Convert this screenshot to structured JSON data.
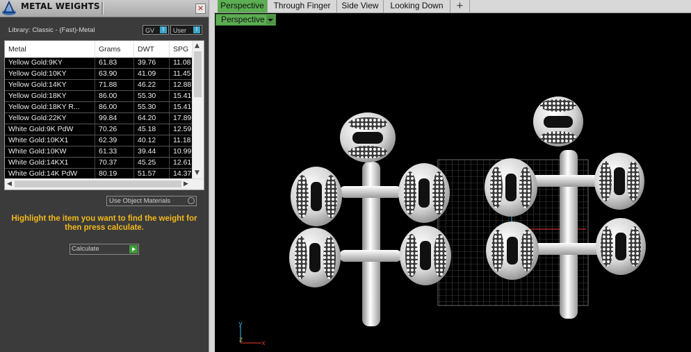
{
  "panel": {
    "title": "METAL WEIGHTS",
    "close_label": "×",
    "library_label": "Library: Classic - (Fast)-Metal",
    "gv_label": "GV",
    "gv_indicator": "I",
    "user_label": "User",
    "user_indicator": "I",
    "table": {
      "columns": [
        "Metal",
        "Grams",
        "DWT",
        "SPG"
      ],
      "rows": [
        [
          "Yellow Gold:9KY",
          "61.83",
          "39.76",
          "11.08"
        ],
        [
          "Yellow Gold:10KY",
          "63.90",
          "41.09",
          "11.45"
        ],
        [
          "Yellow Gold:14KY",
          "71.88",
          "46.22",
          "12.88"
        ],
        [
          "Yellow Gold:18KY",
          "86.00",
          "55.30",
          "15.41"
        ],
        [
          "Yellow Gold:18KY R...",
          "86.00",
          "55.30",
          "15.41"
        ],
        [
          "Yellow Gold:22KY",
          "99.84",
          "64.20",
          "17.89"
        ],
        [
          "White Gold:9K PdW",
          "70.26",
          "45.18",
          "12.59"
        ],
        [
          "White Gold:10KX1",
          "62.39",
          "40.12",
          "11.18"
        ],
        [
          "White Gold:10KW",
          "61.33",
          "39.44",
          "10.99"
        ],
        [
          "White Gold:14KX1",
          "70.37",
          "45.25",
          "12.61"
        ],
        [
          "White Gold:14K PdW",
          "80.19",
          "51.57",
          "14.37"
        ]
      ]
    },
    "use_object_materials_label": "Use Object Materials",
    "instruction": "Highlight the item you want to find the weight for then press calculate.",
    "calculate_label": "Calculate"
  },
  "viewport": {
    "tabs": [
      "Perspective",
      "Through Finger",
      "Side View",
      "Looking Down"
    ],
    "active_tab": "Perspective",
    "add_tab_label": "+",
    "view_dropdown_label": "Perspective",
    "axis_labels": {
      "x": "x",
      "y": "y",
      "z": "z"
    }
  },
  "colors": {
    "accent_green": "#5cae52",
    "instruction_text": "#f2b81c",
    "panel_bg": "#3b3b3b",
    "viewport_bg": "#000000"
  }
}
